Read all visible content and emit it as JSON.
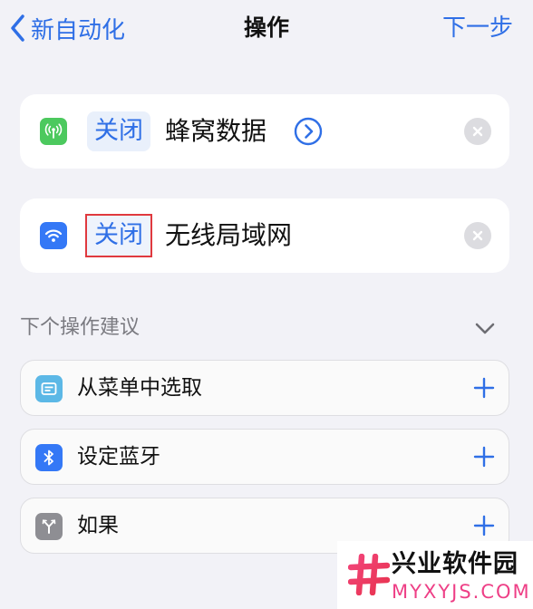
{
  "nav": {
    "back_label": "新自动化",
    "title": "操作",
    "next_label": "下一步"
  },
  "actions": [
    {
      "token": "关闭",
      "text": "蜂窝数据",
      "icon": "cellular-icon",
      "icon_color": "#4cc95e"
    },
    {
      "token": "关闭",
      "text": "无线局域网",
      "icon": "wifi-icon",
      "icon_color": "#3478f6"
    }
  ],
  "suggestions": {
    "title": "下个操作建议",
    "items": [
      {
        "label": "从菜单中选取",
        "icon": "menu-icon",
        "icon_color": "#5cb8e6"
      },
      {
        "label": "设定蓝牙",
        "icon": "bluetooth-icon",
        "icon_color": "#3478f6"
      },
      {
        "label": "如果",
        "icon": "branch-icon",
        "icon_color": "#8e8e93"
      }
    ]
  },
  "watermark": {
    "name": "兴业软件园",
    "url": "MYXYJS.COM"
  },
  "colors": {
    "accent": "#2f6fe6",
    "background": "#f2f2f7",
    "highlight": "#e0393e"
  }
}
